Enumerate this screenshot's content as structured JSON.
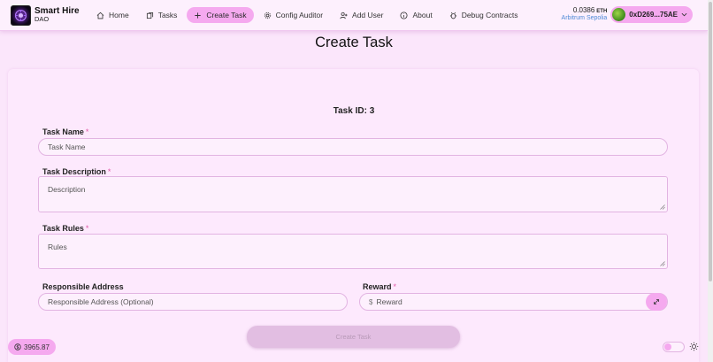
{
  "brand": {
    "title": "Smart Hire",
    "subtitle": "DAO"
  },
  "nav": {
    "items": [
      {
        "label": "Home",
        "icon": "home-icon"
      },
      {
        "label": "Tasks",
        "icon": "tasks-icon"
      },
      {
        "label": "Create Task",
        "icon": "plus-icon",
        "active": true
      },
      {
        "label": "Config Auditor",
        "icon": "gear-icon"
      },
      {
        "label": "Add User",
        "icon": "add-user-icon"
      },
      {
        "label": "About",
        "icon": "info-icon"
      },
      {
        "label": "Debug Contracts",
        "icon": "bug-icon"
      }
    ]
  },
  "wallet": {
    "balance": "0.0386",
    "unit": "ETH",
    "network": "Arbitrum Sepolia",
    "address": "0xD269...75AE"
  },
  "page": {
    "title": "Create Task",
    "task_id": "Task ID: 3"
  },
  "form": {
    "task_name": {
      "label": "Task Name",
      "required": "*",
      "placeholder": "Task Name"
    },
    "task_description": {
      "label": "Task Description",
      "required": "*",
      "placeholder": "Description"
    },
    "task_rules": {
      "label": "Task Rules",
      "required": "*",
      "placeholder": "Rules"
    },
    "responsible_address": {
      "label": "Responsible Address",
      "placeholder": "Responsible Address (Optional)"
    },
    "reward": {
      "label": "Reward",
      "required": "*",
      "prefix": "$",
      "placeholder": "Reward"
    },
    "submit_label": "Create Task"
  },
  "footer": {
    "faucet_value": "3965.87"
  },
  "colors": {
    "accent": "#f5a9ef",
    "background": "#fbe6fb",
    "link": "#4f8ad6",
    "required": "#e05aa6"
  }
}
